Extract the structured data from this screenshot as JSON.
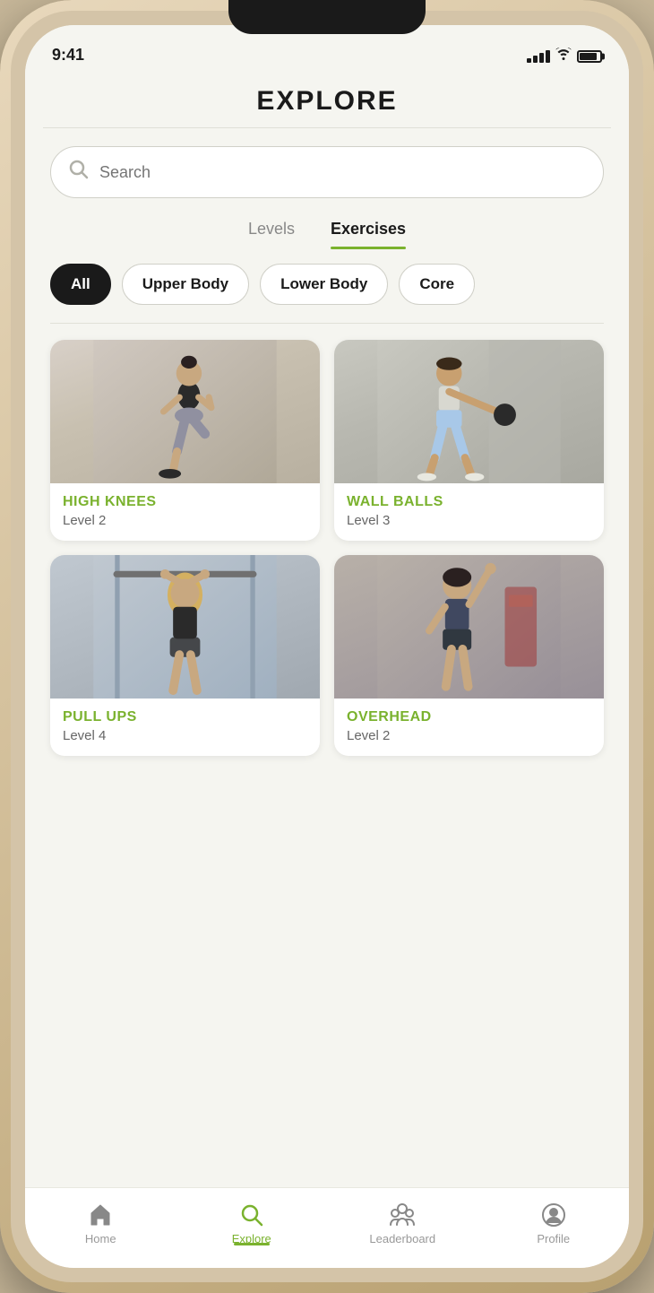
{
  "status": {
    "time": "9:41"
  },
  "page": {
    "title": "EXPLORE"
  },
  "search": {
    "placeholder": "Search"
  },
  "tabs": [
    {
      "id": "levels",
      "label": "Levels",
      "active": false
    },
    {
      "id": "exercises",
      "label": "Exercises",
      "active": true
    }
  ],
  "filters": [
    {
      "id": "all",
      "label": "All",
      "active": true
    },
    {
      "id": "upper-body",
      "label": "Upper Body",
      "active": false
    },
    {
      "id": "lower-body",
      "label": "Lower Body",
      "active": false
    },
    {
      "id": "core",
      "label": "Core",
      "active": false
    }
  ],
  "exercises": [
    {
      "id": "high-knees",
      "name": "HIGH KNEES",
      "level": "Level 2",
      "img_type": "high-knees"
    },
    {
      "id": "wall-balls",
      "name": "WALL BALLS",
      "level": "Level 3",
      "img_type": "wall-balls"
    },
    {
      "id": "pull-ups",
      "name": "PULL UPS",
      "level": "Level 4",
      "img_type": "pullup"
    },
    {
      "id": "stretch",
      "name": "OVERHEAD",
      "level": "Level 2",
      "img_type": "stretch"
    }
  ],
  "nav": {
    "items": [
      {
        "id": "home",
        "label": "Home",
        "active": false
      },
      {
        "id": "explore",
        "label": "Explore",
        "active": true
      },
      {
        "id": "leaderboard",
        "label": "Leaderboard",
        "active": false
      },
      {
        "id": "profile",
        "label": "Profile",
        "active": false
      }
    ]
  }
}
